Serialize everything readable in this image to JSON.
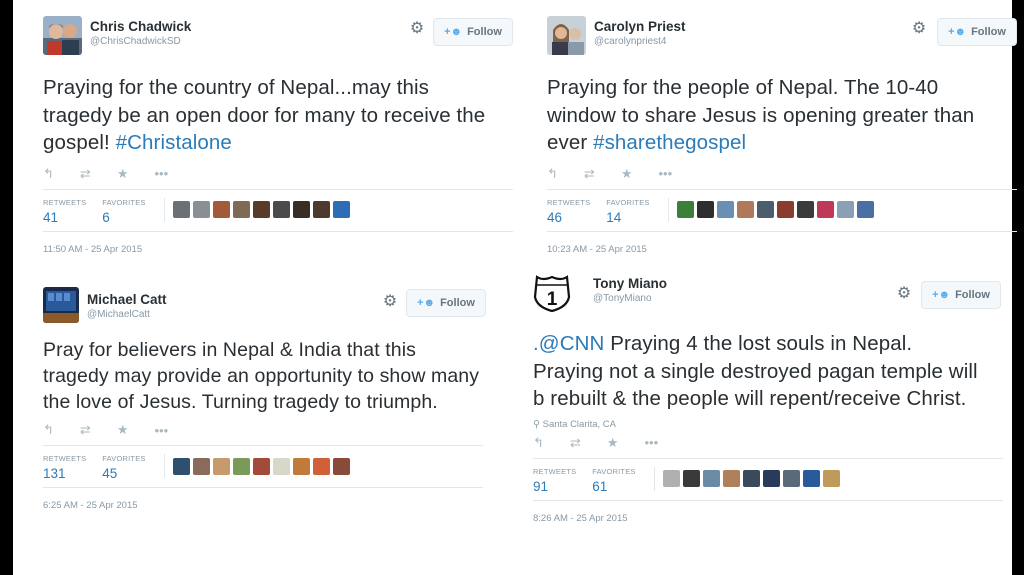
{
  "tweets": [
    {
      "name": "Chris Chadwick",
      "handle": "@ChrisChadwickSD",
      "follow_label": "Follow",
      "text_parts": [
        "Praying for the country of Nepal...may this tragedy be an open door for many to receive the gospel! ",
        "#Christalone"
      ],
      "retweets_label": "RETWEETS",
      "retweets": "41",
      "favorites_label": "FAVORITES",
      "favorites": "6",
      "timestamp": "11:50 AM - 25 Apr 2015",
      "location": "",
      "faces": [
        "#6b7078",
        "#8a8f96",
        "#a35a3a",
        "#7e6a55",
        "#5a3b2a",
        "#4b4b4b",
        "#3a2d24",
        "#4e3a2c",
        "#2d6db5"
      ]
    },
    {
      "name": "Carolyn Priest",
      "handle": "@carolynpriest4",
      "follow_label": "Follow",
      "text_parts": [
        "Praying for the people of Nepal. The 10-40 window to share Jesus is opening greater than ever ",
        "#sharethegospel"
      ],
      "retweets_label": "RETWEETS",
      "retweets": "46",
      "favorites_label": "FAVORITES",
      "favorites": "14",
      "timestamp": "10:23 AM - 25 Apr 2015",
      "location": "",
      "faces": [
        "#3a7f3a",
        "#2e2e2e",
        "#6a8fb5",
        "#b07a5a",
        "#4d5d6d",
        "#8a3d2d",
        "#3b3b3b",
        "#c0395a",
        "#8aa0b5",
        "#4b6fa5"
      ]
    },
    {
      "name": "Michael Catt",
      "handle": "@MichaelCatt",
      "follow_label": "Follow",
      "text_parts": [
        "Pray for believers in Nepal & India that this tragedy may provide an opportunity to show many the love of Jesus. Turning tragedy to triumph.",
        ""
      ],
      "retweets_label": "RETWEETS",
      "retweets": "131",
      "favorites_label": "FAVORITES",
      "favorites": "45",
      "timestamp": "6:25 AM - 25 Apr 2015",
      "location": "",
      "faces": [
        "#2f4f6f",
        "#8a6a5a",
        "#c69a6a",
        "#7a9a5a",
        "#a34a3a",
        "#d8d8c8",
        "#c07a3a",
        "#d0603a",
        "#8a4a3a"
      ]
    },
    {
      "name": "Tony Miano",
      "handle": "@TonyMiano",
      "follow_label": "Follow",
      "text_parts": [
        ".@CNN",
        " Praying 4 the lost souls in Nepal. Praying not a single destroyed pagan temple will b rebuilt & the people will repent/receive Christ."
      ],
      "retweets_label": "RETWEETS",
      "retweets": "91",
      "favorites_label": "FAVORITES",
      "favorites": "61",
      "timestamp": "8:26 AM - 25 Apr 2015",
      "location": "Santa Clarita, CA",
      "faces": [
        "#b0b0b0",
        "#3a3a3a",
        "#6a8aa5",
        "#b0805a",
        "#3a4a5a",
        "#2a3a5a",
        "#5a6a7a",
        "#2a5a9a",
        "#c09a5a"
      ]
    }
  ],
  "icons": [
    "reply-icon",
    "retweet-icon",
    "favorite-icon",
    "more-icon",
    "gear-icon",
    "follow-add-icon",
    "location-pin-icon"
  ]
}
